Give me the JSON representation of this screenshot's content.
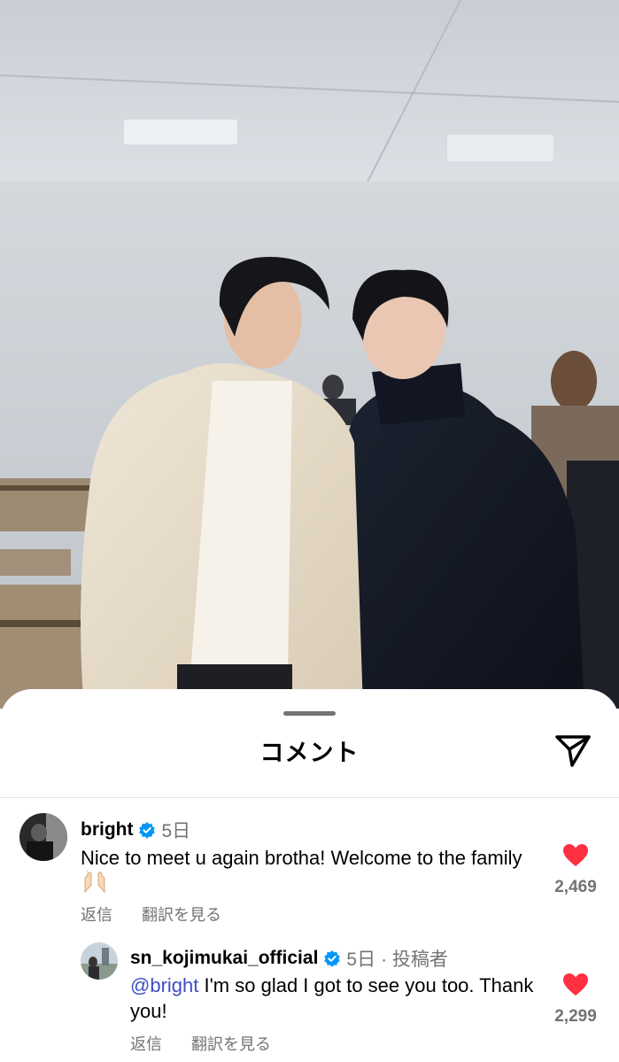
{
  "sheet": {
    "title": "コメント",
    "share_icon": "paper-plane-icon"
  },
  "colors": {
    "like_red": "#ff3040",
    "verified_blue": "#0095f6",
    "mention_blue": "#3d4ec7",
    "secondary_text": "#737373"
  },
  "comments": [
    {
      "username": "bright",
      "verified": true,
      "time": "5日",
      "text": "Nice to meet u again brotha! Welcome to the family",
      "emoji": "raising-hands",
      "reply_label": "返信",
      "translate_label": "翻訳を見る",
      "like_count": "2,469",
      "liked": true
    },
    {
      "username": "sn_kojimukai_official",
      "verified": true,
      "time": "5日",
      "author_tag": "· 投稿者",
      "mention": "@bright",
      "text": " I'm so glad I got to see you too. Thank you!",
      "reply_label": "返信",
      "translate_label": "翻訳を見る",
      "like_count": "2,299",
      "liked": true
    }
  ]
}
